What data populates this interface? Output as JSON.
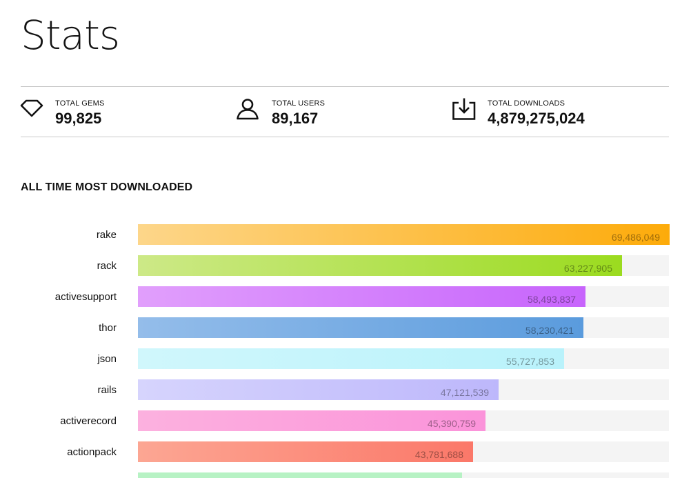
{
  "page": {
    "title": "Stats"
  },
  "stats": [
    {
      "label": "TOTAL GEMS",
      "value": "99,825",
      "icon": "gem-icon"
    },
    {
      "label": "TOTAL USERS",
      "value": "89,167",
      "icon": "user-icon"
    },
    {
      "label": "TOTAL DOWNLOADS",
      "value": "4,879,275,024",
      "icon": "download-icon"
    }
  ],
  "section": {
    "title": "ALL TIME MOST DOWNLOADED"
  },
  "chart_data": {
    "type": "bar",
    "orientation": "horizontal",
    "title": "ALL TIME MOST DOWNLOADED",
    "categories": [
      "rake",
      "rack",
      "activesupport",
      "thor",
      "json",
      "rails",
      "activerecord",
      "actionpack"
    ],
    "values": [
      69486049,
      63227905,
      58493837,
      58230421,
      55727853,
      47121539,
      45390759,
      43781688
    ],
    "value_labels": [
      "69,486,049",
      "63,227,905",
      "58,493,837",
      "58,230,421",
      "55,727,853",
      "47,121,539",
      "45,390,759",
      "43,781,688"
    ],
    "xlim": [
      0,
      69486049
    ],
    "grid": false,
    "legend": "none",
    "colors": [
      [
        "#fdd68a",
        "#fdab0a"
      ],
      [
        "#cde987",
        "#9bdb1f"
      ],
      [
        "#e19ffc",
        "#c764fc"
      ],
      [
        "#94bdea",
        "#5a9bdd"
      ],
      [
        "#d0f7fc",
        "#b9f2fb"
      ],
      [
        "#d6d4fd",
        "#bdb7fb"
      ],
      [
        "#fcb1df",
        "#fb93da"
      ],
      [
        "#fca693",
        "#fb7869"
      ]
    ],
    "next_bar_color": "#b7f2c4",
    "track_color": "#f4f4f4"
  }
}
